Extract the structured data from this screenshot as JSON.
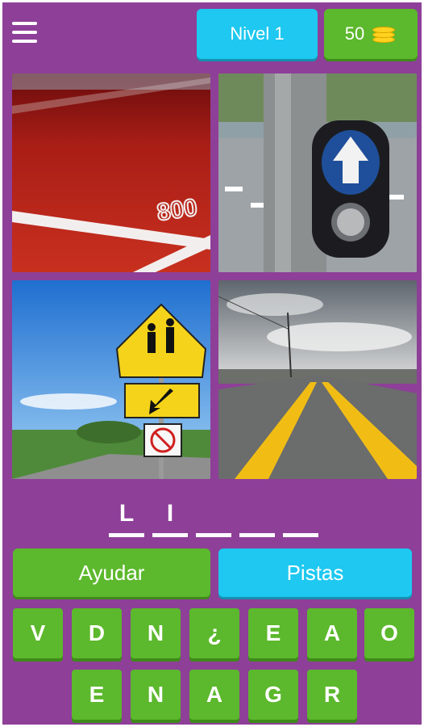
{
  "header": {
    "level_label": "Nivel 1",
    "coins": "50",
    "coin_icon": "coin-stack-icon",
    "menu_icon": "hamburger-menu-icon"
  },
  "images": [
    {
      "icon": "running-track-photo",
      "painted_text": "800"
    },
    {
      "icon": "crosswalk-button-photo"
    },
    {
      "icon": "school-crossing-sign-photo"
    },
    {
      "icon": "road-with-yellow-lines-photo"
    }
  ],
  "answer": {
    "slots": [
      "L",
      "I",
      "",
      "",
      ""
    ]
  },
  "actions": {
    "help_label": "Ayudar",
    "hints_label": "Pistas"
  },
  "keyboard": {
    "row1": [
      "V",
      "D",
      "N",
      "¿",
      "E",
      "A",
      "O"
    ],
    "row2": [
      "E",
      "N",
      "A",
      "G",
      "R"
    ]
  },
  "colors": {
    "background": "#8e3f98",
    "green": "#5cb82c",
    "blue": "#1ec8f0",
    "coin": "#ffd21f"
  }
}
